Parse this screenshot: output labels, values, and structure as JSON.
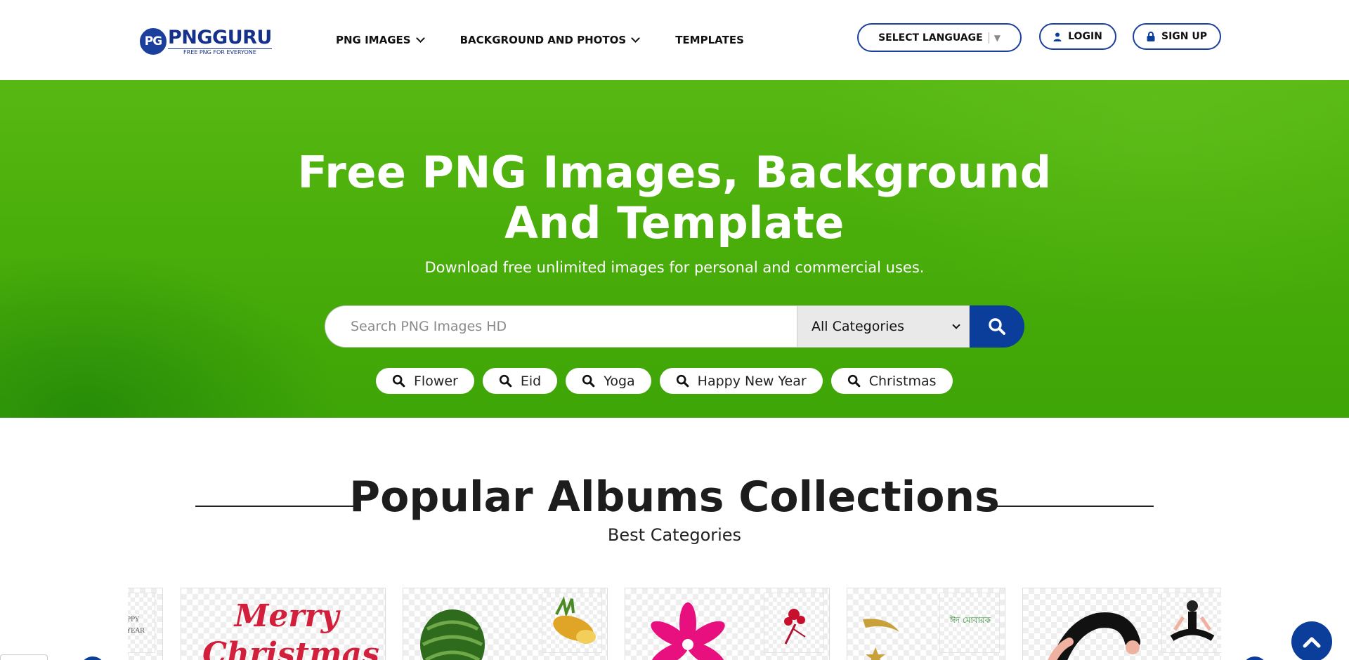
{
  "brand": {
    "name": "PNGGURU",
    "badge": "PG",
    "tagline": "FREE PNG FOR EVERYONE",
    "color": "#16318a"
  },
  "nav": {
    "items": [
      {
        "label": "PNG IMAGES",
        "has_dropdown": true
      },
      {
        "label": "BACKGROUND AND PHOTOS",
        "has_dropdown": true
      },
      {
        "label": "TEMPLATES",
        "has_dropdown": false
      }
    ],
    "language_label": "SELECT LANGUAGE",
    "language_arrow": "▼",
    "login_label": "LOGIN",
    "signup_label": "SIGN UP"
  },
  "hero": {
    "title": "Free PNG Images, Background And Template",
    "subtitle": "Download free unlimited images for personal and commercial uses.",
    "search_placeholder": "Search PNG Images HD",
    "category_selected": "All Categories",
    "tags": [
      "Flower",
      "Eid",
      "Yoga",
      "Happy New Year",
      "Christmas"
    ],
    "background_color": "#4aae0a"
  },
  "popular": {
    "title": "Popular Albums Collections",
    "subtitle": "Best Categories",
    "albums": [
      {
        "theme": "happy-new-year",
        "snippet": "PPY YEAR"
      },
      {
        "theme": "merry-christmas",
        "snippet": "Merry Christmas"
      },
      {
        "theme": "fruits",
        "snippet": ""
      },
      {
        "theme": "flower",
        "snippet": ""
      },
      {
        "theme": "eid",
        "snippet": "ঈদ মোবারক"
      },
      {
        "theme": "yoga",
        "snippet": ""
      }
    ]
  },
  "colors": {
    "primary": "#0b3d9a",
    "text": "#111111"
  }
}
